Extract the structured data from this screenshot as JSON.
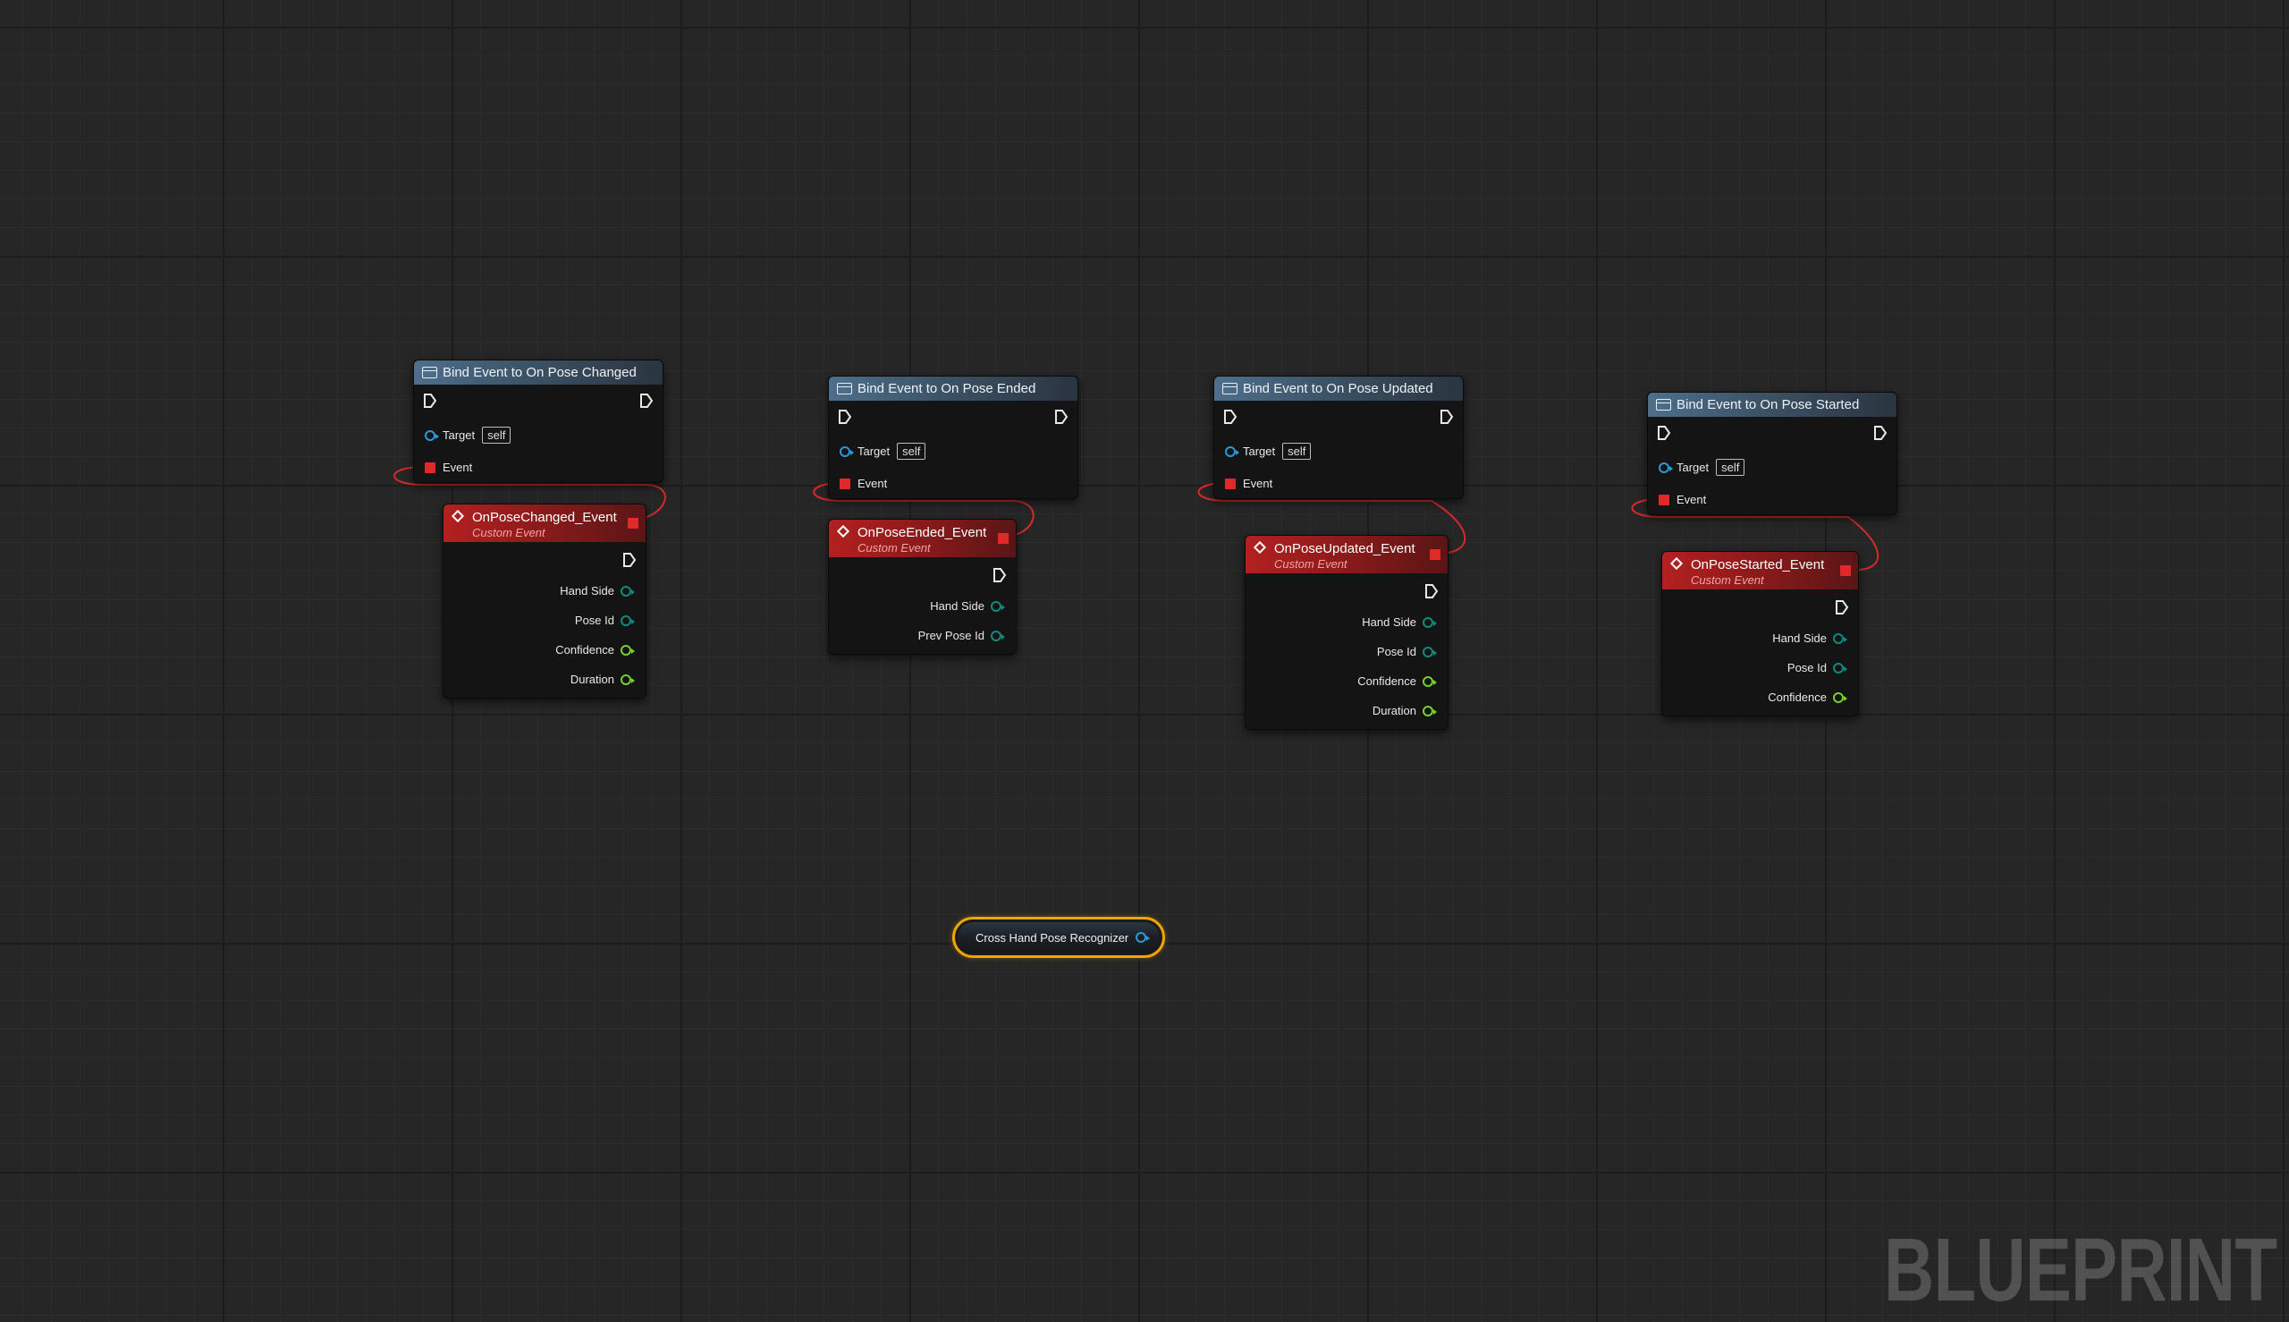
{
  "bind_nodes": [
    {
      "title": "Bind Event to On Pose Changed",
      "target_label": "Target",
      "target_value": "self",
      "event_label": "Event"
    },
    {
      "title": "Bind Event to On Pose Ended",
      "target_label": "Target",
      "target_value": "self",
      "event_label": "Event"
    },
    {
      "title": "Bind Event to On Pose Updated",
      "target_label": "Target",
      "target_value": "self",
      "event_label": "Event"
    },
    {
      "title": "Bind Event to On Pose Started",
      "target_label": "Target",
      "target_value": "self",
      "event_label": "Event"
    }
  ],
  "event_nodes": [
    {
      "title": "OnPoseChanged_Event",
      "subtitle": "Custom Event",
      "outputs": [
        {
          "label": "Hand Side",
          "type": "teal"
        },
        {
          "label": "Pose Id",
          "type": "teal"
        },
        {
          "label": "Confidence",
          "type": "green"
        },
        {
          "label": "Duration",
          "type": "green"
        }
      ]
    },
    {
      "title": "OnPoseEnded_Event",
      "subtitle": "Custom Event",
      "outputs": [
        {
          "label": "Hand Side",
          "type": "teal"
        },
        {
          "label": "Prev Pose Id",
          "type": "teal"
        }
      ]
    },
    {
      "title": "OnPoseUpdated_Event",
      "subtitle": "Custom Event",
      "outputs": [
        {
          "label": "Hand Side",
          "type": "teal"
        },
        {
          "label": "Pose Id",
          "type": "teal"
        },
        {
          "label": "Confidence",
          "type": "green"
        },
        {
          "label": "Duration",
          "type": "green"
        }
      ]
    },
    {
      "title": "OnPoseStarted_Event",
      "subtitle": "Custom Event",
      "outputs": [
        {
          "label": "Hand Side",
          "type": "teal"
        },
        {
          "label": "Pose Id",
          "type": "teal"
        },
        {
          "label": "Confidence",
          "type": "green"
        }
      ]
    }
  ],
  "variable_node": {
    "label": "Cross Hand Pose Recognizer"
  },
  "watermark": "BLUEPRINT",
  "colors": {
    "function_header": "#4e6f8c",
    "event_header": "#b32020",
    "delegate_pin": "#e02a2a",
    "object_pin": "#2c9ad6",
    "enum_pin": "#0f8a80",
    "float_pin": "#78cf31",
    "selection_outline": "#f0a500"
  }
}
